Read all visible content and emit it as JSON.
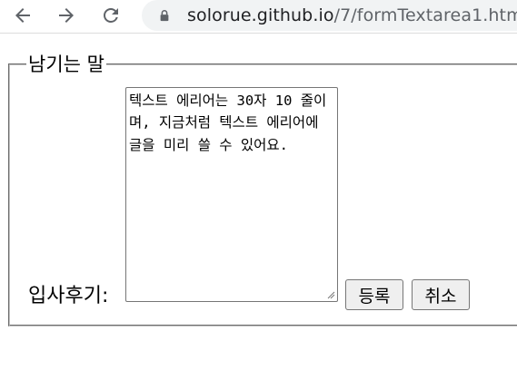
{
  "browser": {
    "url_host": "solorue.github.io",
    "url_path": "/7/formTextarea1.htm"
  },
  "form": {
    "legend": "남기는 말",
    "review_label": "입사후기:",
    "textarea_value": "텍스트 에리어는 30자 10 줄이며, 지금처럼 텍스트 에리어에 글을 미리 쓸 수 있어요.",
    "submit_label": "등록",
    "cancel_label": "취소"
  }
}
